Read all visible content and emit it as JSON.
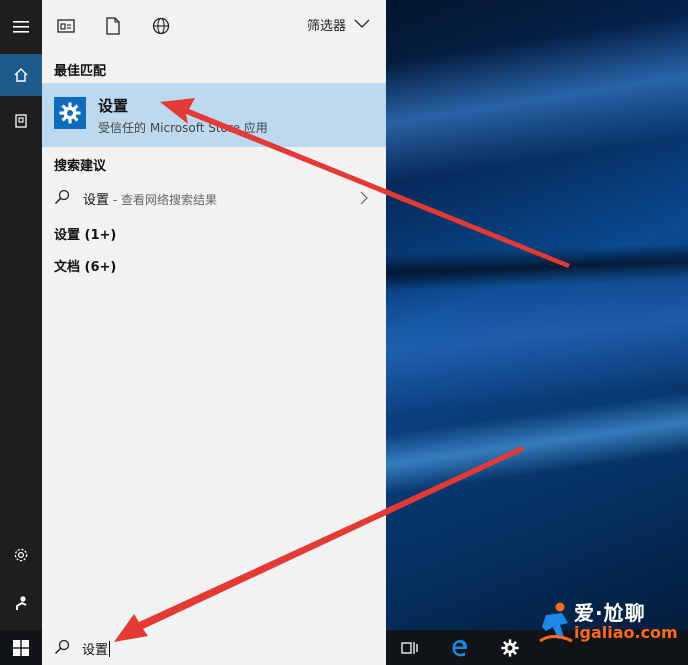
{
  "toolbar": {
    "filter_label": "筛选器"
  },
  "sections": {
    "best_match": "最佳匹配",
    "suggestions": "搜索建议",
    "settings_group": "设置 (1+)",
    "documents_group": "文档 (6+)"
  },
  "best_match_item": {
    "name": "设置",
    "subtitle": "受信任的 Microsoft Store 应用"
  },
  "suggestion": {
    "term": "设置",
    "hint": " - 查看网络搜索结果"
  },
  "taskbar": {
    "search_value": "设置"
  },
  "watermark": {
    "brand": "爱·尬聊",
    "site": "igaliao.com"
  },
  "colors": {
    "accent": "#0f6cbd",
    "selected_bg": "#bcd9ef",
    "arrow": "#e53935",
    "watermark_orange": "#ff6a1a"
  },
  "icons": {
    "rail": [
      "hamburger-menu-icon",
      "home-icon",
      "documents-icon",
      "settings-icon",
      "user-icon"
    ],
    "toolbar": [
      "apps-icon",
      "document-icon",
      "web-globe-icon",
      "chevron-down-icon"
    ],
    "taskbar": [
      "windows-start-icon",
      "search-icon",
      "task-view-icon",
      "edge-icon",
      "settings-gear-icon"
    ]
  }
}
